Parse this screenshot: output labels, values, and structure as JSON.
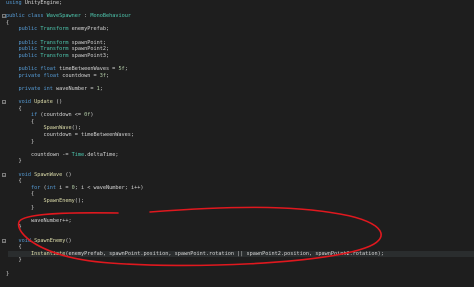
{
  "editor": {
    "lines": [
      [
        {
          "t": "using ",
          "c": "kw"
        },
        {
          "t": "UnityEngine;",
          "c": "pl"
        }
      ],
      [],
      [
        {
          "t": "public class ",
          "c": "kw"
        },
        {
          "t": "WaveSpawner",
          "c": "ty"
        },
        {
          "t": " : ",
          "c": "pl"
        },
        {
          "t": "MonoBehaviour",
          "c": "ty"
        }
      ],
      [
        {
          "t": "{",
          "c": "pl"
        }
      ],
      [
        {
          "t": "    public ",
          "c": "kw"
        },
        {
          "t": "Transform",
          "c": "ty"
        },
        {
          "t": " enemyPrefab;",
          "c": "pl"
        }
      ],
      [],
      [
        {
          "t": "    public ",
          "c": "kw"
        },
        {
          "t": "Transform",
          "c": "ty"
        },
        {
          "t": " spawnPoint;",
          "c": "pl"
        }
      ],
      [
        {
          "t": "    public ",
          "c": "kw"
        },
        {
          "t": "Transform",
          "c": "ty"
        },
        {
          "t": " spawnPoint2;",
          "c": "pl"
        }
      ],
      [
        {
          "t": "    public ",
          "c": "kw"
        },
        {
          "t": "Transform",
          "c": "ty"
        },
        {
          "t": " spawnPoint3;",
          "c": "pl"
        }
      ],
      [],
      [
        {
          "t": "    public float ",
          "c": "kw"
        },
        {
          "t": "timeBetweenWaves = ",
          "c": "pl"
        },
        {
          "t": "5f",
          "c": "lit"
        },
        {
          "t": ";",
          "c": "pl"
        }
      ],
      [
        {
          "t": "    private float ",
          "c": "kw"
        },
        {
          "t": "countdown = ",
          "c": "pl"
        },
        {
          "t": "3f",
          "c": "lit"
        },
        {
          "t": ";",
          "c": "pl"
        }
      ],
      [],
      [
        {
          "t": "    private int ",
          "c": "kw"
        },
        {
          "t": "waveNumber = ",
          "c": "pl"
        },
        {
          "t": "1",
          "c": "lit"
        },
        {
          "t": ";",
          "c": "pl"
        }
      ],
      [],
      [
        {
          "t": "    void ",
          "c": "kw"
        },
        {
          "t": "Update",
          "c": "fn"
        },
        {
          "t": " ()",
          "c": "pl"
        }
      ],
      [
        {
          "t": "    {",
          "c": "pl"
        }
      ],
      [
        {
          "t": "        if ",
          "c": "kw"
        },
        {
          "t": "(countdown <= ",
          "c": "pl"
        },
        {
          "t": "0f",
          "c": "lit"
        },
        {
          "t": ")",
          "c": "pl"
        }
      ],
      [
        {
          "t": "        {",
          "c": "pl"
        }
      ],
      [
        {
          "t": "            ",
          "c": "pl"
        },
        {
          "t": "SpawnWave",
          "c": "fn"
        },
        {
          "t": "();",
          "c": "pl"
        }
      ],
      [
        {
          "t": "            countdown = timeBetweenWaves;",
          "c": "pl"
        }
      ],
      [
        {
          "t": "        }",
          "c": "pl"
        }
      ],
      [],
      [
        {
          "t": "        countdown -= ",
          "c": "pl"
        },
        {
          "t": "Time",
          "c": "ty"
        },
        {
          "t": ".deltaTime;",
          "c": "pl"
        }
      ],
      [
        {
          "t": "    }",
          "c": "pl"
        }
      ],
      [],
      [
        {
          "t": "    void ",
          "c": "kw"
        },
        {
          "t": "SpawnWave",
          "c": "fn"
        },
        {
          "t": " ()",
          "c": "pl"
        }
      ],
      [
        {
          "t": "    {",
          "c": "pl"
        }
      ],
      [
        {
          "t": "        for ",
          "c": "kw"
        },
        {
          "t": "(",
          "c": "pl"
        },
        {
          "t": "int ",
          "c": "kw"
        },
        {
          "t": "i = ",
          "c": "pl"
        },
        {
          "t": "0",
          "c": "lit"
        },
        {
          "t": "; i < waveNumber; i++)",
          "c": "pl"
        }
      ],
      [
        {
          "t": "        {",
          "c": "pl"
        }
      ],
      [
        {
          "t": "            ",
          "c": "pl"
        },
        {
          "t": "SpawnEnemy",
          "c": "fn"
        },
        {
          "t": "();",
          "c": "pl"
        }
      ],
      [
        {
          "t": "        }",
          "c": "pl"
        }
      ],
      [],
      [
        {
          "t": "        waveNumber++;",
          "c": "pl"
        }
      ],
      [
        {
          "t": "    }",
          "c": "pl"
        }
      ],
      [],
      [
        {
          "t": "    void ",
          "c": "kw"
        },
        {
          "t": "SpawnEnemy",
          "c": "fn"
        },
        {
          "t": "()",
          "c": "pl"
        }
      ],
      [
        {
          "t": "    {",
          "c": "pl"
        }
      ],
      [
        {
          "t": "        ",
          "c": "pl"
        },
        {
          "t": "Instantiate",
          "c": "fn"
        },
        {
          "t": "(enemyPrefab, spawnPoint.position, spawnPoint.rotation || spawnPoint2.position, spawnPoint2.rotation);",
          "c": "pl"
        }
      ],
      [
        {
          "t": "    }",
          "c": "pl"
        }
      ],
      [],
      [
        {
          "t": "}",
          "c": "pl"
        }
      ]
    ],
    "fold_lines": [
      2,
      15,
      26,
      36
    ],
    "current_line": 38,
    "annotation_color": "#e0181e"
  }
}
